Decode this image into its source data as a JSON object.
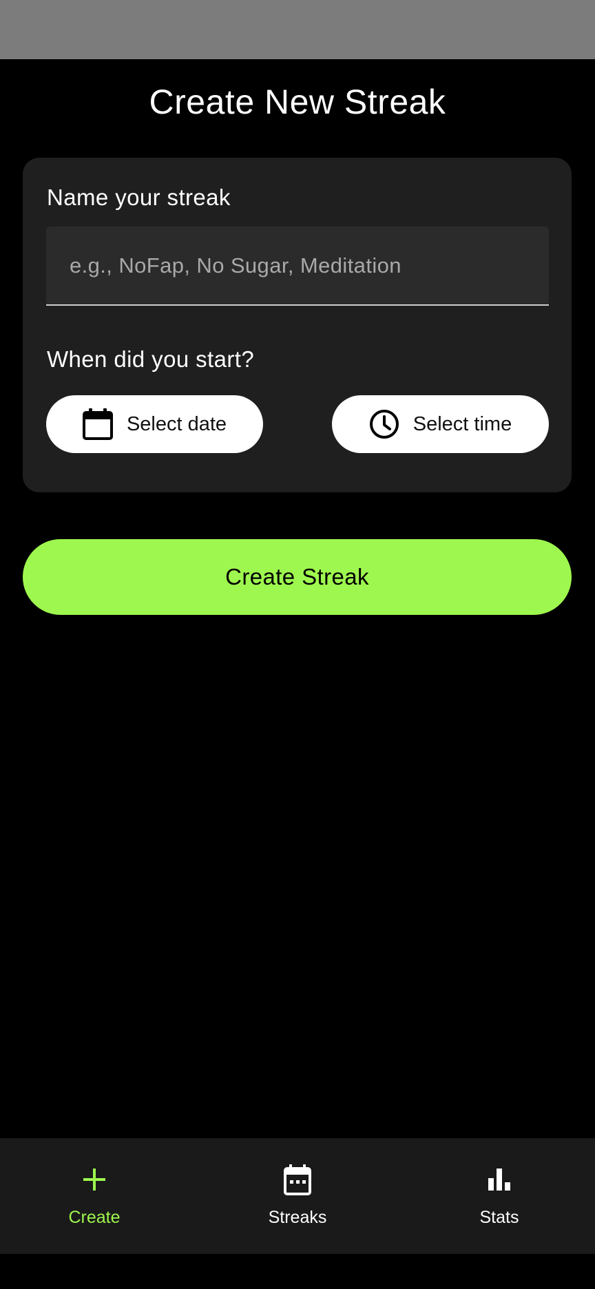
{
  "page": {
    "title": "Create New Streak"
  },
  "form": {
    "name_label": "Name your streak",
    "name_value": "",
    "name_placeholder": "e.g., NoFap, No Sugar, Meditation",
    "start_label": "When did you start?",
    "date_button": {
      "label": "Select date",
      "icon": "calendar-icon"
    },
    "time_button": {
      "label": "Select time",
      "icon": "clock-icon"
    }
  },
  "actions": {
    "create_label": "Create Streak"
  },
  "nav": {
    "items": [
      {
        "label": "Create",
        "icon": "plus-icon",
        "active": true
      },
      {
        "label": "Streaks",
        "icon": "calendar-icon",
        "active": false
      },
      {
        "label": "Stats",
        "icon": "bar-chart-icon",
        "active": false
      }
    ]
  },
  "colors": {
    "accent": "#9ef74e",
    "background": "#000000",
    "card": "#1f1f1f",
    "status_bar": "#7c7c7c",
    "nav_background": "#1a1a1a"
  }
}
